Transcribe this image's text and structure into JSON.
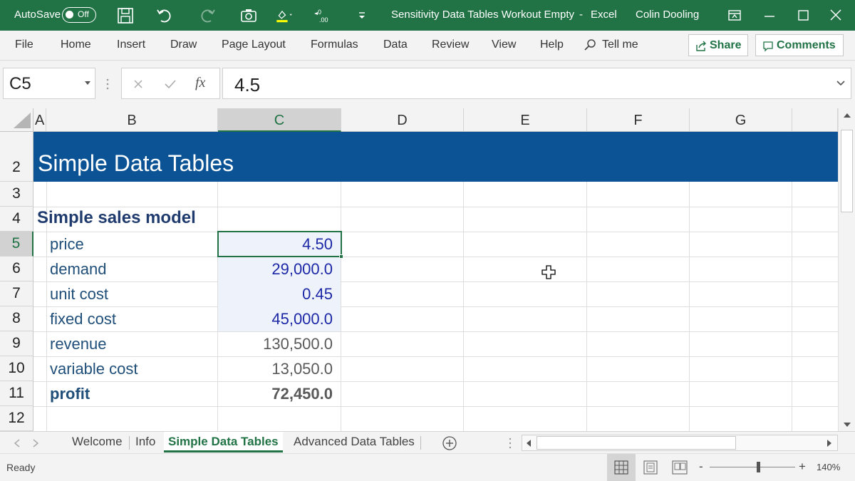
{
  "titlebar": {
    "autosave_label": "AutoSave",
    "autosave_state": "Off",
    "doc_title": "Sensitivity Data Tables Workout Empty",
    "separator": "-",
    "app_name": "Excel",
    "user_name": "Colin Dooling",
    "icons": [
      "save-icon",
      "undo-icon",
      "redo-icon",
      "camera-icon",
      "fill-color-icon",
      "decrease-decimal-icon",
      "customize-toolbar-icon",
      "ribbon-display-icon",
      "minimize-icon",
      "maximize-icon",
      "close-icon"
    ]
  },
  "ribbon": {
    "tabs": [
      "File",
      "Home",
      "Insert",
      "Draw",
      "Page Layout",
      "Formulas",
      "Data",
      "Review",
      "View",
      "Help"
    ],
    "tell_me": "Tell me",
    "share_label": "Share",
    "comments_label": "Comments"
  },
  "formula_bar": {
    "name_box": "C5",
    "fx_label": "fx",
    "formula_value": "4.5"
  },
  "grid": {
    "columns": [
      "A",
      "B",
      "C",
      "D",
      "E",
      "F",
      "G"
    ],
    "selected_column": "C",
    "rows": [
      "2",
      "3",
      "4",
      "5",
      "6",
      "7",
      "8",
      "9",
      "10",
      "11",
      "12"
    ],
    "selected_row": "5",
    "banner_title": "Simple Data Tables",
    "section_title": "Simple sales model",
    "model": [
      {
        "label": "price",
        "value": "4.50",
        "kind": "input"
      },
      {
        "label": "demand",
        "value": "29,000.0",
        "kind": "input"
      },
      {
        "label": "unit cost",
        "value": "0.45",
        "kind": "input"
      },
      {
        "label": "fixed cost",
        "value": "45,000.0",
        "kind": "input"
      },
      {
        "label": "revenue",
        "value": "130,500.0",
        "kind": "calc"
      },
      {
        "label": "variable cost",
        "value": "13,050.0",
        "kind": "calc"
      },
      {
        "label": "profit",
        "value": "72,450.0",
        "kind": "total"
      }
    ],
    "colors": {
      "banner": "#0b5394",
      "input_text": "#1c27a6",
      "label_text": "#1f4e79",
      "accent": "#217346"
    }
  },
  "sheet_tabs": {
    "tabs": [
      "Welcome",
      "Info",
      "Simple Data Tables",
      "Advanced Data Tables"
    ],
    "active": "Simple Data Tables"
  },
  "status_bar": {
    "status": "Ready",
    "zoom": "140%",
    "zoom_minus": "-",
    "zoom_plus": "+"
  }
}
